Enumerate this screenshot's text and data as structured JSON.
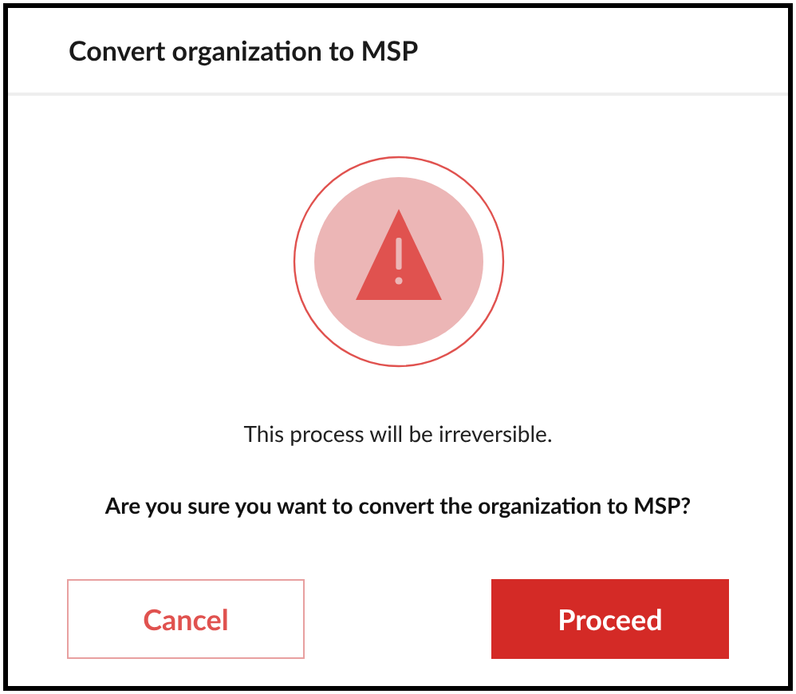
{
  "dialog": {
    "title": "Convert organization to MSP",
    "message": "This process will be irreversible.",
    "question": "Are you sure you want to convert the organization to MSP?"
  },
  "buttons": [
    {
      "label": "Cancel",
      "kind": "secondary"
    },
    {
      "label": "Proceed",
      "kind": "primary"
    }
  ]
}
